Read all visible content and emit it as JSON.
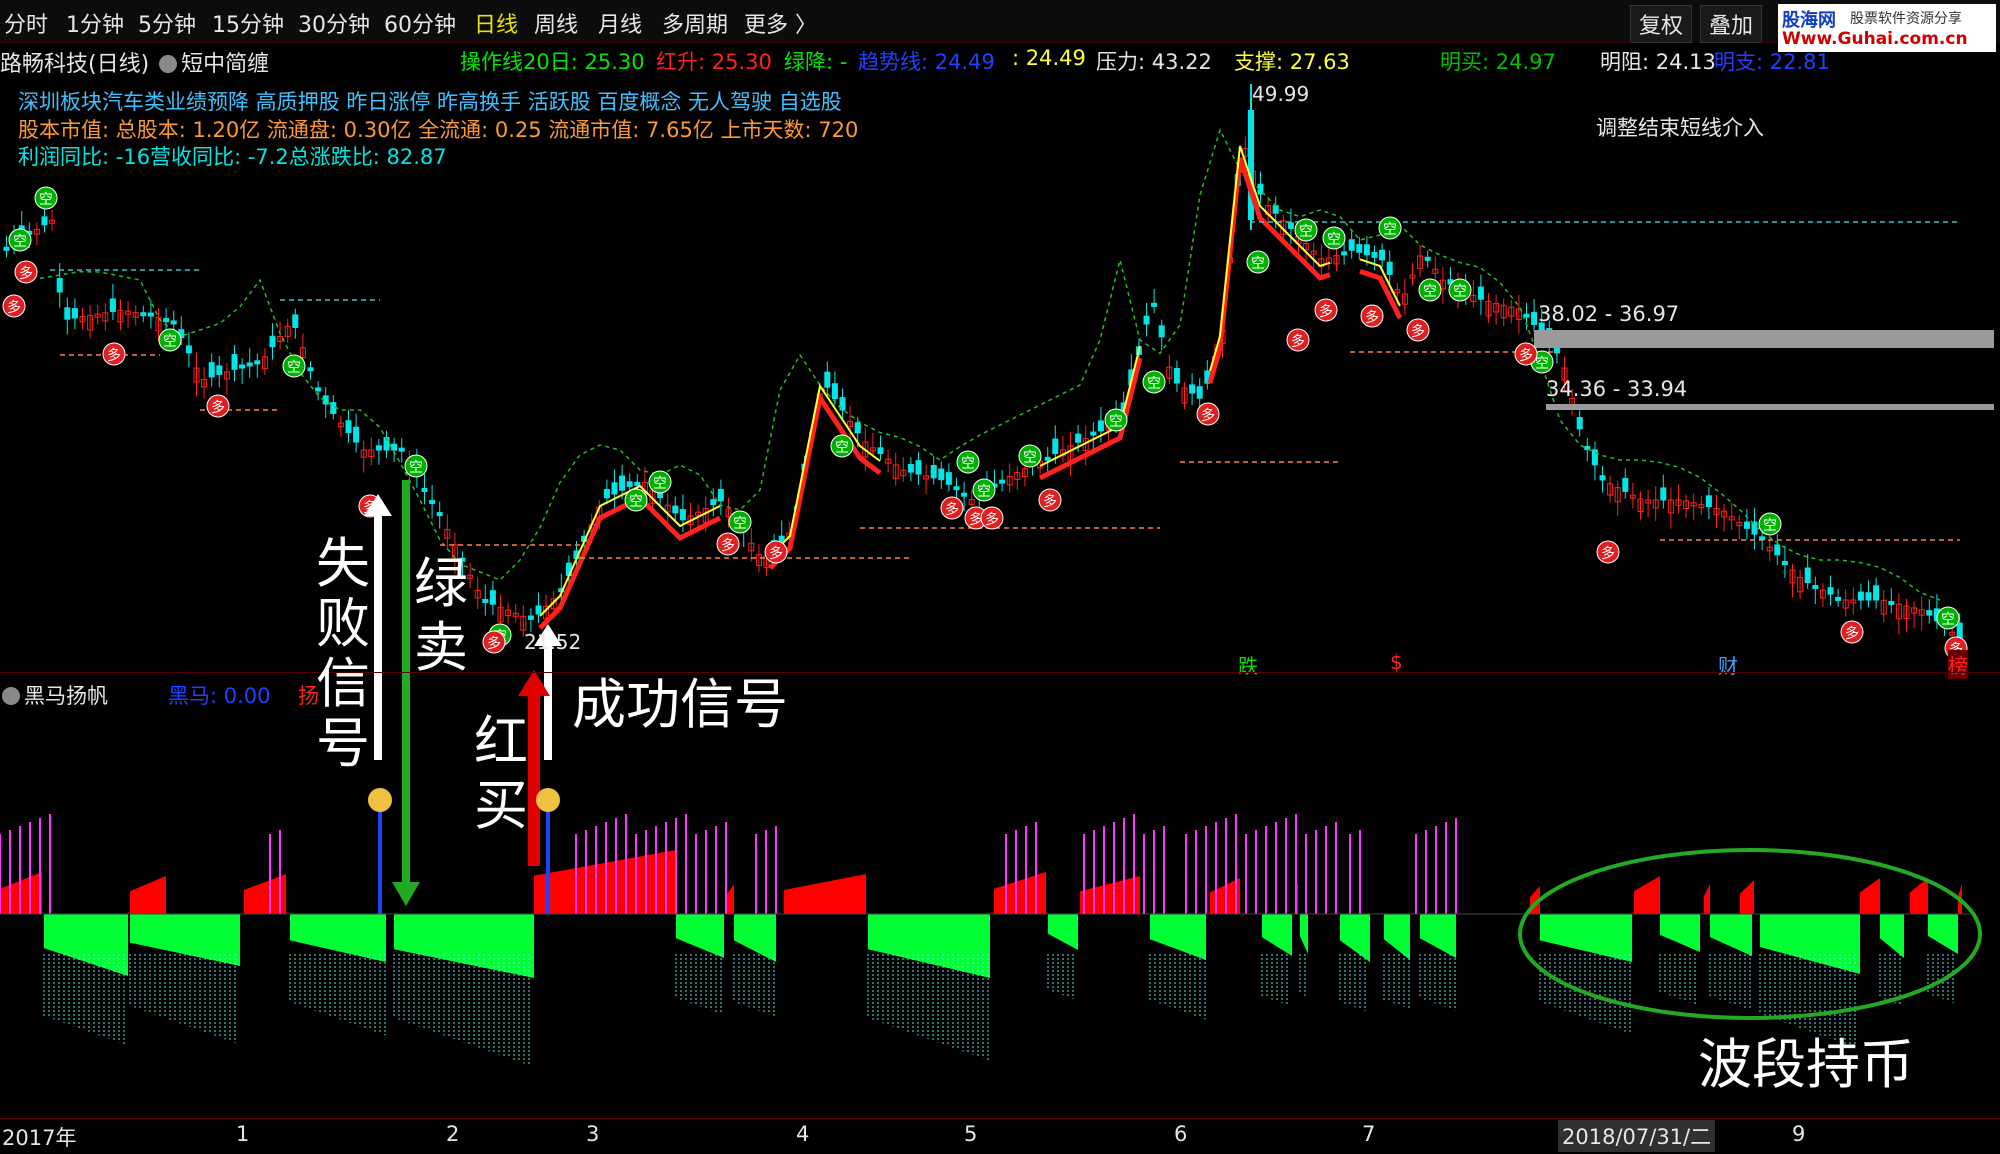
{
  "toolbar": {
    "periods": [
      "分时",
      "1分钟",
      "5分钟",
      "15分钟",
      "30分钟",
      "60分钟",
      "日线",
      "周线",
      "月线",
      "多周期",
      "更多 〉"
    ],
    "active_period": "日线",
    "right_buttons": [
      "复权",
      "叠加"
    ],
    "logo": {
      "site": "股海网",
      "tagline": "股票软件资源分享",
      "url": "Www.Guhai.com.cn"
    }
  },
  "header": {
    "stock_title": "路畅科技(日线)",
    "indicator_name": "短中简缠",
    "values": [
      {
        "label": "操作线20日:",
        "value": "25.30",
        "color": "#00e600"
      },
      {
        "label": "红升:",
        "value": "25.30",
        "color": "#ff2020"
      },
      {
        "label": "绿降:",
        "value": "-",
        "color": "#00e600"
      },
      {
        "label": "趋势线:",
        "value": "24.49",
        "color": "#2040ff"
      },
      {
        "label": ":",
        "value": "24.49",
        "color": "#ffff40"
      },
      {
        "label": "压力:",
        "value": "43.22",
        "color": "#e6e6e6"
      },
      {
        "label": "支撑:",
        "value": "27.63",
        "color": "#ffff40"
      },
      {
        "label": "明买:",
        "value": "24.97",
        "color": "#00c000"
      },
      {
        "label": "明阻:",
        "value": "24.13",
        "color": "#e6e6e6"
      },
      {
        "label": "明支:",
        "value": "22.81",
        "color": "#2040ff"
      }
    ],
    "concepts": "深圳板块汽车类业绩预降 高质押股 昨日涨停 昨高换手 活跃股 百度概念 无人驾驶 自选股",
    "capital": "股本市值: 总股本: 1.20亿 流通盘: 0.30亿 全流通: 0.25 流通市值: 7.65亿 上市天数: 720",
    "profit": "利润同比: -16营收同比: -7.2总涨跌比: 82.87",
    "note": "调整结束短线介入"
  },
  "price_labels": {
    "high": "49.99",
    "low": "21.52",
    "zone1": "38.02 - 36.97",
    "zone2": "34.36 - 33.94"
  },
  "markers": {
    "sell": "空",
    "buy": "多"
  },
  "event_tags": [
    "跌",
    "$",
    "财",
    "榜"
  ],
  "sub_panel": {
    "name": "黑马扬帆",
    "values": [
      {
        "label": "黑马:",
        "value": "0.00",
        "color": "#2040ff"
      },
      {
        "label": "扬",
        "value": "",
        "color": "#ff2020"
      }
    ]
  },
  "annotations": {
    "fail_signal": "失败信号",
    "green_sell": "绿卖",
    "success_signal": "成功信号",
    "red_buy": "红买",
    "wave_hold": "波段持币"
  },
  "time_axis": {
    "year": "2017年",
    "months": [
      "1",
      "2",
      "3",
      "4",
      "5",
      "6",
      "7",
      "9"
    ],
    "cursor_date": "2018/07/31/二"
  },
  "colors": {
    "up": "#ff2020",
    "down": "#00e6e6",
    "buy_marker": "#e02020",
    "sell_marker": "#00b000",
    "osc_green": "#00ff33",
    "osc_red": "#ff0000",
    "osc_magenta": "#ff33ff",
    "osc_cyan": "#66e6e6"
  }
}
